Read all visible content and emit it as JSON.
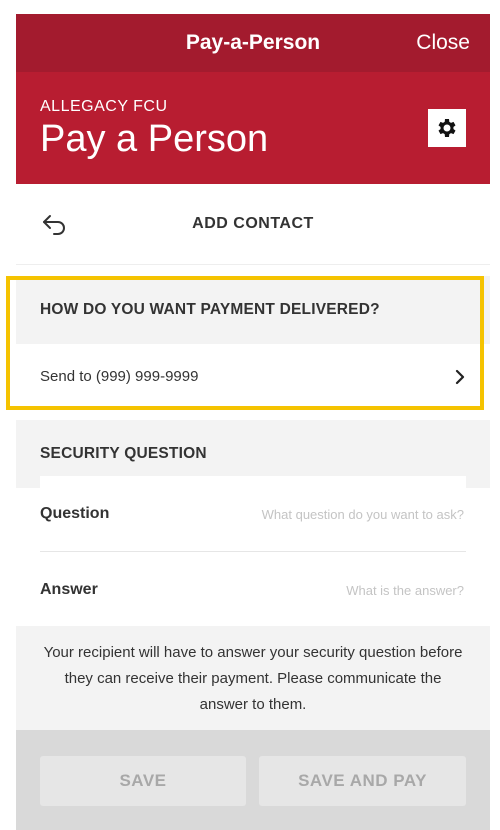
{
  "topbar": {
    "title": "Pay-a-Person",
    "close_label": "Close"
  },
  "header": {
    "org": "ALLEGACY FCU",
    "title": "Pay a Person",
    "settings_icon": "gear-icon"
  },
  "nav": {
    "back_icon": "back-arrow-icon",
    "title": "ADD CONTACT"
  },
  "delivery": {
    "heading": "HOW DO YOU WANT PAYMENT DELIVERED?",
    "value": "Send to (999) 999-9999",
    "chevron_icon": "chevron-right-icon"
  },
  "security": {
    "heading": "SECURITY QUESTION",
    "question_label": "Question",
    "question_placeholder": "What question do you want to ask?",
    "answer_label": "Answer",
    "answer_placeholder": "What is the answer?",
    "note": "Your recipient will have to answer your security question before they can receive their payment. Please communicate the answer to them."
  },
  "footer": {
    "save_label": "SAVE",
    "save_and_pay_label": "SAVE AND PAY"
  },
  "colors": {
    "topbar": "#a31b2e",
    "header": "#b81d31",
    "highlight": "#f5c300",
    "section_bg": "#f3f3f3",
    "footer_bg": "#d9d9d9"
  }
}
